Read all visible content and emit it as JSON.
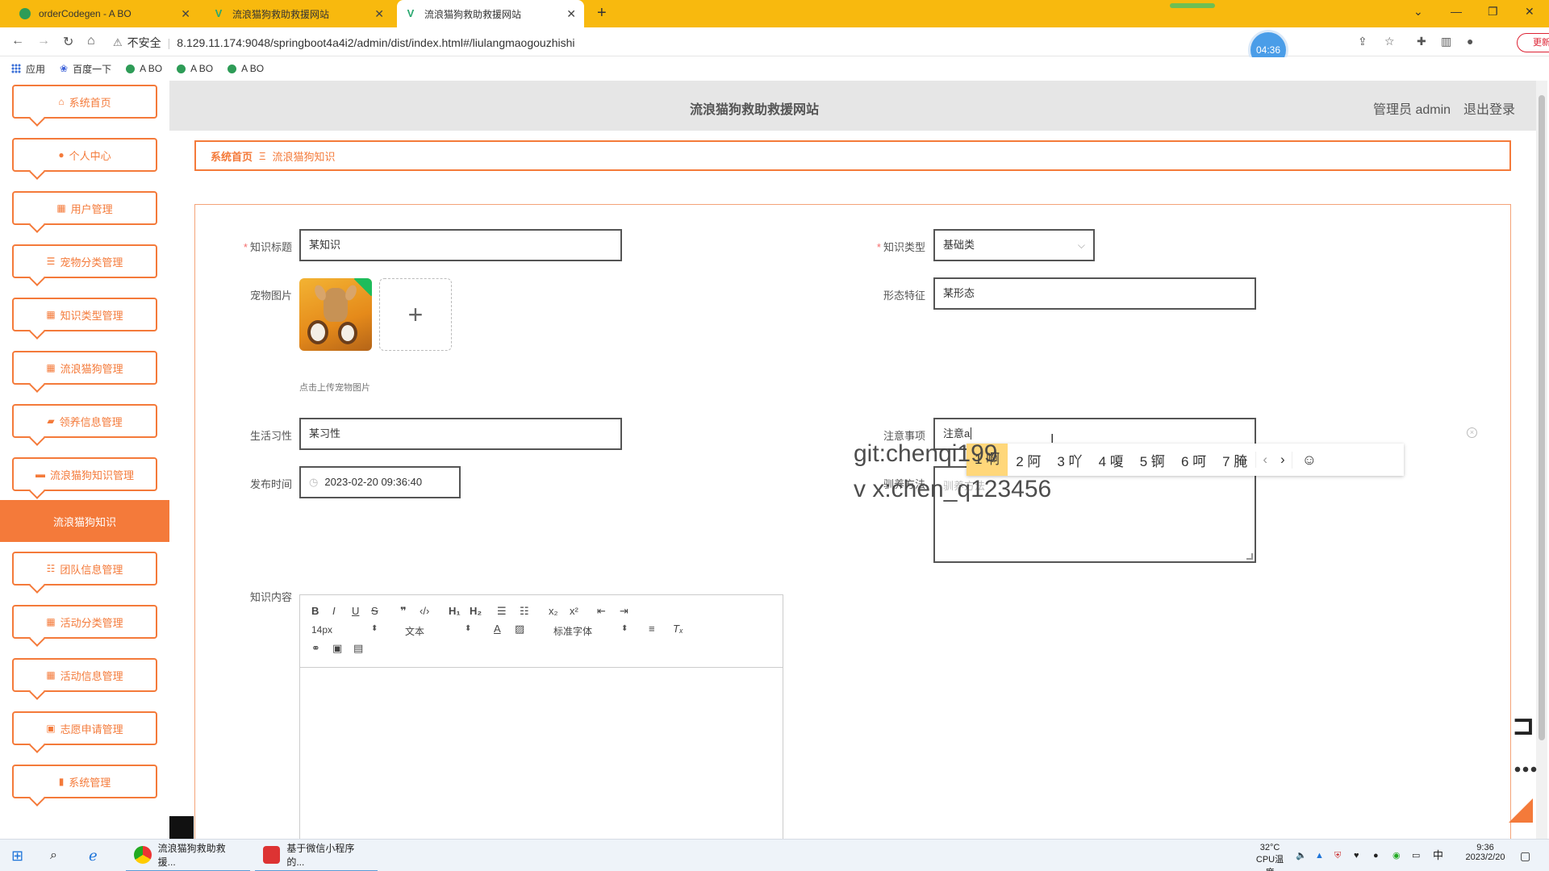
{
  "browser": {
    "tabs": [
      {
        "title": "orderCodegen - A BO",
        "active": false
      },
      {
        "title": "流浪猫狗救助救援网站",
        "active": false
      },
      {
        "title": "流浪猫狗救助救援网站",
        "active": true
      }
    ],
    "address": {
      "security": "不安全",
      "url": "8.129.11.174:9048/springboot4a4i2/admin/dist/index.html#/liulangmaogouzhishi"
    },
    "timer": "04:36",
    "update_label": "更新",
    "bookmarks": [
      "应用",
      "百度一下",
      "A BO",
      "A BO",
      "A BO"
    ]
  },
  "sidebar": {
    "items": [
      {
        "label": "系统首页",
        "icon": "home-icon"
      },
      {
        "label": "个人中心",
        "icon": "user-icon"
      },
      {
        "label": "用户管理",
        "icon": "grid-icon"
      },
      {
        "label": "宠物分类管理",
        "icon": "list-icon"
      },
      {
        "label": "知识类型管理",
        "icon": "grid-icon"
      },
      {
        "label": "流浪猫狗管理",
        "icon": "grid-icon"
      },
      {
        "label": "领养信息管理",
        "icon": "ticket-icon"
      },
      {
        "label": "流浪猫狗知识管理",
        "icon": "briefcase-icon"
      }
    ],
    "active": "流浪猫狗知识",
    "items_after": [
      {
        "label": "团队信息管理",
        "icon": "sliders-icon"
      },
      {
        "label": "活动分类管理",
        "icon": "grid-icon"
      },
      {
        "label": "活动信息管理",
        "icon": "grid-icon"
      },
      {
        "label": "志愿申请管理",
        "icon": "clipboard-icon"
      },
      {
        "label": "系统管理",
        "icon": "bar-chart-icon"
      }
    ]
  },
  "header": {
    "title": "流浪猫狗救助救援网站",
    "user": "管理员 admin",
    "logout": "退出登录"
  },
  "breadcrumb": {
    "home": "系统首页",
    "current": "流浪猫狗知识"
  },
  "form": {
    "title_label": "知识标题",
    "title_value": "某知识",
    "type_label": "知识类型",
    "type_value": "基础类",
    "image_label": "宠物图片",
    "upload_hint": "点击上传宠物图片",
    "feature_label": "形态特征",
    "feature_value": "某形态",
    "habit_label": "生活习性",
    "habit_value": "某习性",
    "notice_label": "注意事项",
    "notice_value": "注意a",
    "time_label": "发布时间",
    "time_value": "2023-02-20 09:36:40",
    "method_label": "驯养方法",
    "method_placeholder": "驯养方法",
    "content_label": "知识内容"
  },
  "editor": {
    "font_size": "14px",
    "block_type": "文本",
    "font_family": "标准字体"
  },
  "ime": {
    "candidates": [
      "1 啊",
      "2 阿",
      "3 吖",
      "4 嗄",
      "5 锕",
      "6 呵",
      "7 腌"
    ]
  },
  "watermark": {
    "line1": "git:chenqi199",
    "line2": "v x:chen_q123456"
  },
  "taskbar": {
    "tasks": [
      "流浪猫狗救助救援...",
      "基于微信小程序的..."
    ],
    "temperature": "32°C",
    "cpu_label": "CPU温度",
    "ime_mode": "中",
    "time": "9:36",
    "date": "2023/2/20"
  }
}
